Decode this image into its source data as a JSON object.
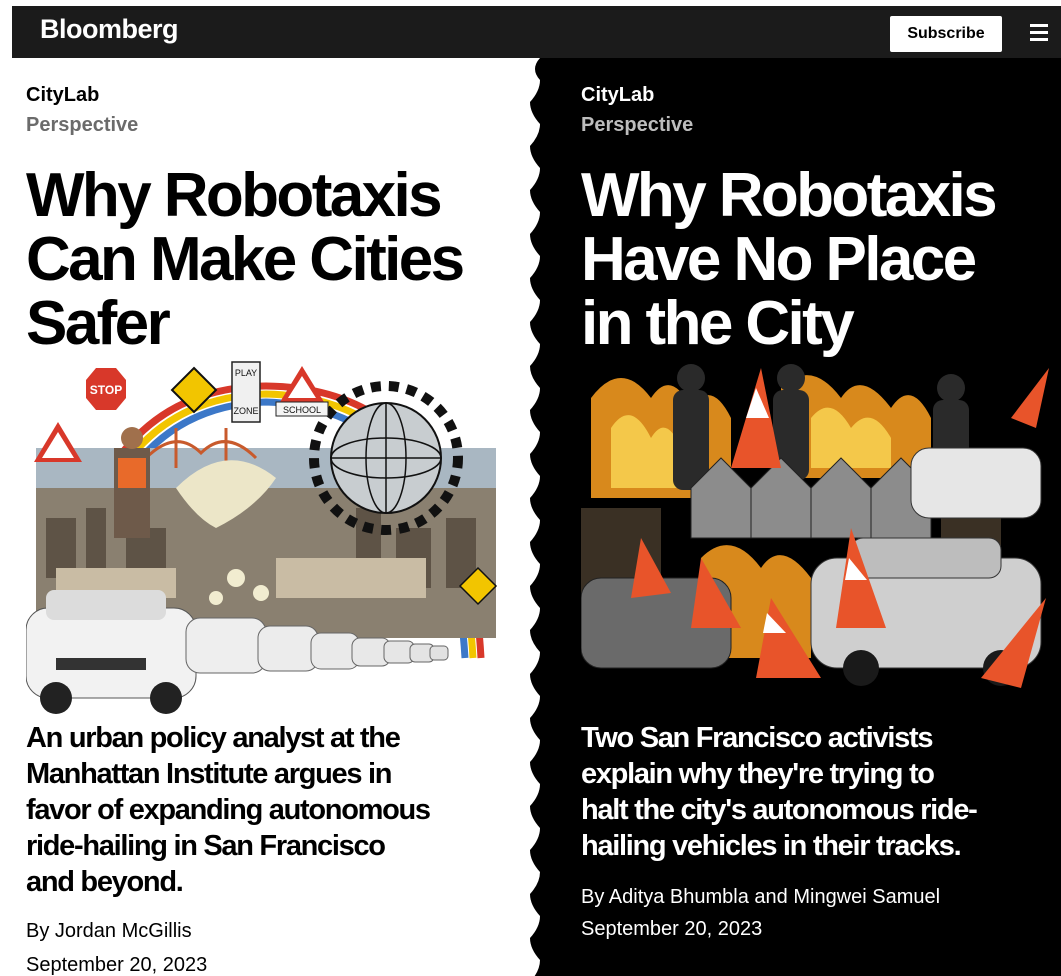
{
  "header": {
    "logo": "Bloomberg",
    "subscribe_label": "Subscribe",
    "menu_icon": "hamburger-menu-icon"
  },
  "colors": {
    "nav_background": "#1b1b1b",
    "right_panel": "#000000",
    "cone_orange": "#e8542a",
    "sign_yellow": "#f2c500"
  },
  "articles": [
    {
      "section": "CityLab",
      "subsection": "Perspective",
      "headline_lines": [
        "Why Robotaxis",
        "Can Make Cities",
        "Safer"
      ],
      "dek_lines": [
        "An urban policy analyst at the",
        "Manhattan Institute argues in",
        "favor of expanding autonomous",
        "ride-hailing in San Francisco",
        "and beyond."
      ],
      "byline": "By Jordan McGillis",
      "date": "September 20, 2023",
      "image_signs": [
        "STOP",
        "PLAY",
        "ZONE",
        "SCHOOL"
      ]
    },
    {
      "section": "CityLab",
      "subsection": "Perspective",
      "headline_lines": [
        "Why Robotaxis",
        "Have No Place",
        "in the City"
      ],
      "dek_lines": [
        "Two San Francisco activists",
        "explain why they're trying to",
        "halt the city's autonomous ride-",
        "hailing vehicles in their tracks."
      ],
      "byline": "By Aditya Bhumbla and Mingwei Samuel",
      "date": "September 20, 2023"
    }
  ]
}
